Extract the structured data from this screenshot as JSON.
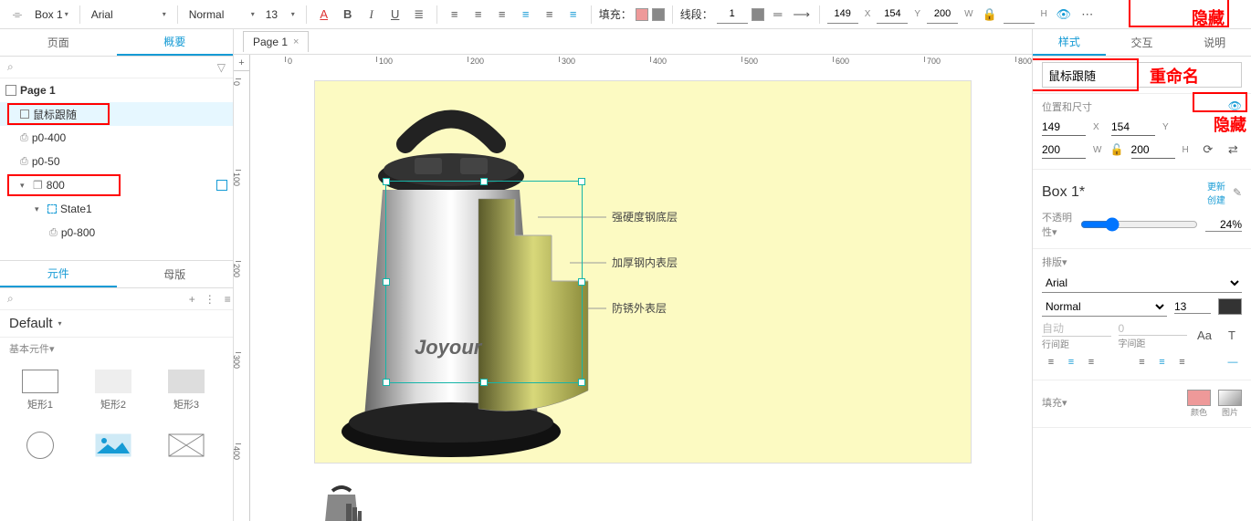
{
  "toolbar": {
    "element_name": "Box 1",
    "font": "Arial",
    "weight": "Normal",
    "size": "13",
    "fill_label": "填充：",
    "stroke_label": "线段：",
    "stroke_w": "1",
    "x": "149",
    "y": "154",
    "w": "200",
    "h": "",
    "fill_color": "#e99",
    "fill_color2": "#888"
  },
  "left_tabs": {
    "page": "页面",
    "outline": "概要"
  },
  "outline": {
    "page": "Page 1",
    "items": [
      {
        "name": "鼠标跟随",
        "icon": "box",
        "indent": 1,
        "selected": true
      },
      {
        "name": "p0-400",
        "icon": "dp",
        "indent": 1
      },
      {
        "name": "p0-50",
        "icon": "dp",
        "indent": 1
      },
      {
        "name": "800",
        "icon": "stack",
        "indent": 1,
        "expandable": true,
        "end_marker": true
      },
      {
        "name": "State1",
        "icon": "state",
        "indent": 2,
        "expandable": true
      },
      {
        "name": "p0-800",
        "icon": "dp",
        "indent": 3
      }
    ]
  },
  "lib_tabs": {
    "widgets": "元件",
    "masters": "母版"
  },
  "lib": {
    "default": "Default",
    "section": "基本元件▾",
    "shapes": [
      "矩形1",
      "矩形2",
      "矩形3"
    ]
  },
  "page_tab": "Page 1",
  "ruler_h": [
    "0",
    "100",
    "200",
    "300",
    "400",
    "500",
    "600",
    "700",
    "800"
  ],
  "ruler_v": [
    "0",
    "100",
    "200",
    "300",
    "400"
  ],
  "canvas_annotations": {
    "a1": "强硬度钢底层",
    "a2": "加厚钢内表层",
    "a3": "防锈外表层",
    "brand": "Joyour"
  },
  "right_tabs": {
    "style": "样式",
    "interact": "交互",
    "notes": "说明"
  },
  "right": {
    "style_name": "鼠标跟随",
    "pos_label": "位置和尺寸",
    "x": "149",
    "y": "154",
    "w": "200",
    "h": "200",
    "box_style": "Box 1*",
    "update_create": "更新\n创建",
    "opacity_label": "不透明性▾",
    "opacity": "24%",
    "typo_label": "排版▾",
    "font": "Arial",
    "weight": "Normal",
    "size": "13",
    "auto": "自动",
    "zero": "0",
    "line_h": "行间距",
    "letter": "字间距",
    "fill_label": "填充▾",
    "color_lbl": "颜色",
    "image_lbl": "图片"
  },
  "anno": {
    "hide1": "隐藏",
    "rename": "重命名",
    "hide2": "隐藏"
  }
}
